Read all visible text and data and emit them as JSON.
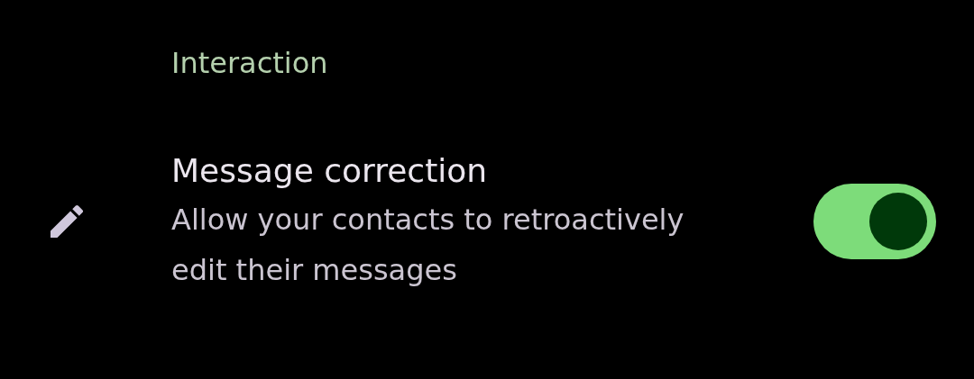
{
  "section": {
    "title": "Interaction"
  },
  "setting": {
    "title": "Message correction",
    "description": "Allow your contacts to retroactively edit their messages",
    "on": true
  }
}
